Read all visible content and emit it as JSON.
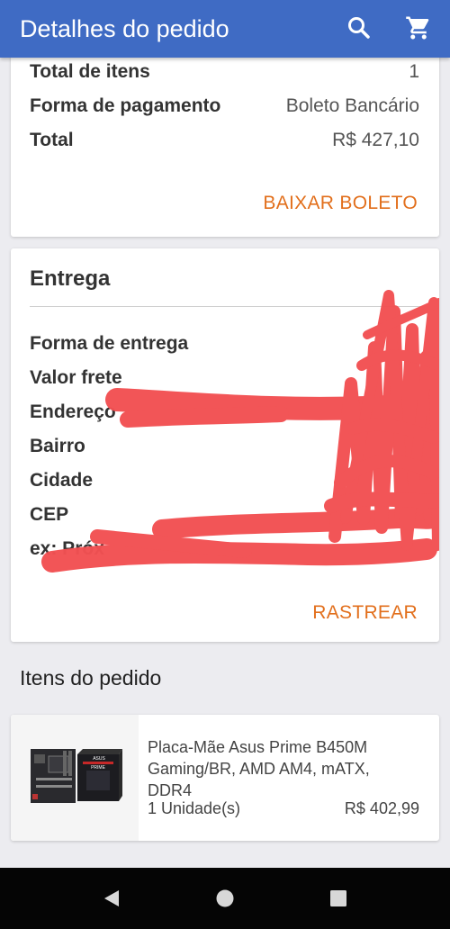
{
  "appbar": {
    "title": "Detalhes do pedido",
    "search_icon": "search-icon",
    "cart_icon": "cart-icon"
  },
  "summary": {
    "rows": [
      {
        "label": "Total de itens",
        "value": "1"
      },
      {
        "label": "Forma de pagamento",
        "value": "Boleto Bancário"
      },
      {
        "label": "Total",
        "value": "R$ 427,10"
      }
    ],
    "action_label": "BAIXAR BOLETO"
  },
  "delivery": {
    "title": "Entrega",
    "rows": [
      {
        "label": "Forma de entrega"
      },
      {
        "label": "Valor frete"
      },
      {
        "label": "Endereço"
      },
      {
        "label": "Bairro"
      },
      {
        "label": "Cidade"
      },
      {
        "label": "CEP"
      },
      {
        "label": "ex: Próx"
      }
    ],
    "action_label": "RASTREAR"
  },
  "items": {
    "heading": "Itens do pedido",
    "list": [
      {
        "name": "Placa-Mãe Asus Prime B450M Gaming/BR, AMD AM4, mATX, DDR4",
        "quantity": "1 Unidade(s)",
        "price": "R$ 402,99",
        "box_brand": "ASUS",
        "box_model": "PRIME"
      }
    ]
  },
  "colors": {
    "appbar": "#3f6bc4",
    "action": "#e26f1c",
    "redaction": "#f25052",
    "background": "#ececf0"
  },
  "system_nav": {
    "back_icon": "back-icon",
    "home_icon": "home-icon",
    "recents_icon": "recents-icon"
  }
}
